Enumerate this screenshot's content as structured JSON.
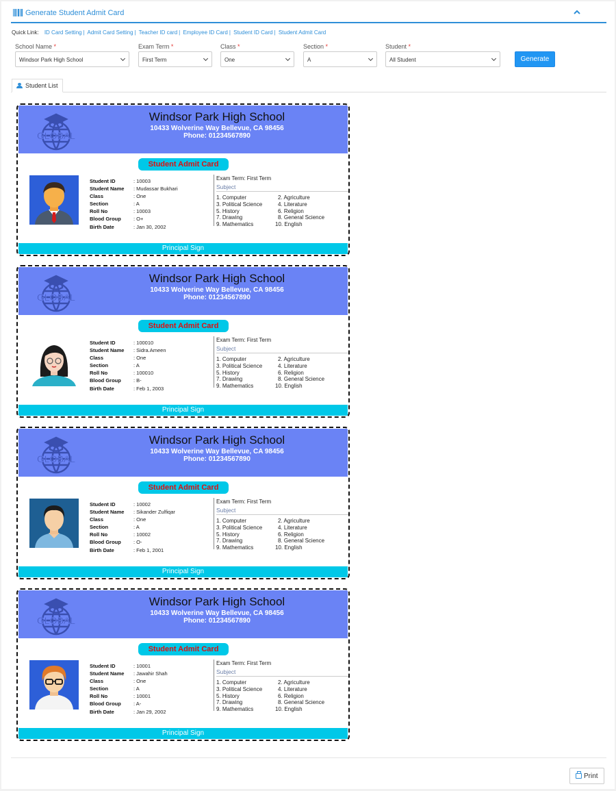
{
  "header": {
    "title": "Generate Student Admit Card",
    "collapse_icon": "chevron-up-icon"
  },
  "quick_links": {
    "label": "Quick Link:",
    "items": [
      "ID Card Setting",
      "Admit Card Setting",
      "Teacher ID card",
      "Employee ID Card",
      "Student ID Card",
      "Student Admit Card"
    ]
  },
  "filters": {
    "school": {
      "label": "School Name",
      "required": "*",
      "value": "Windsor Park High School"
    },
    "exam_term": {
      "label": "Exam Term",
      "required": "*",
      "value": "First Term"
    },
    "class": {
      "label": "Class",
      "required": "*",
      "value": "One"
    },
    "section": {
      "label": "Section",
      "required": "*",
      "value": "A"
    },
    "student": {
      "label": "Student",
      "required": "*",
      "value": "All Student"
    }
  },
  "generate_label": "Generate",
  "tab_label": "Student List",
  "field_labels": {
    "student_id": "Student ID",
    "student_name": "Student Name",
    "class": "Class",
    "section": "Section",
    "roll_no": "Roll No",
    "blood_group": "Blood Group",
    "birth_date": "Birth Date"
  },
  "card_common": {
    "school_name": "Windsor Park High School",
    "address": "10433 Wolverine Way Bellevue, CA 98456",
    "phone": "Phone: 01234567890",
    "logo_text": "GLOBAL",
    "badge": "Student Admit Card",
    "exam_term": "Exam Term: First Term",
    "subject_title": "Subject",
    "subjects": [
      "1. Computer",
      "2. Agriculture",
      "3. Political Science",
      "4. Literature",
      "5. History",
      "6. Religion",
      "7. Drawing",
      "8. General Science",
      "9. Mathematics",
      "10. English"
    ],
    "footer": "Principal Sign",
    "colors": {
      "header_bg": "#6a83f5",
      "accent": "#00c8e8",
      "badge_text": "#dd1111"
    }
  },
  "cards": [
    {
      "student_id": ": 10003",
      "student_name": ": Mudassar Bukhari",
      "class": ": One",
      "section": ": A",
      "roll_no": ": 10003",
      "blood_group": ": O+",
      "birth_date": ": Jan 30, 2002",
      "avatar": "male-avatar-tie-icon"
    },
    {
      "student_id": ": 100010",
      "student_name": ": Sidra.Ameen",
      "class": ": One",
      "section": ": A",
      "roll_no": ": 100010",
      "blood_group": ": B-",
      "birth_date": ": Feb 1, 2003",
      "avatar": "female-avatar-glasses-icon"
    },
    {
      "student_id": ": 10002",
      "student_name": ": Sikander Zulfiqar",
      "class": ": One",
      "section": ": A",
      "roll_no": ": 10002",
      "blood_group": ": O-",
      "birth_date": ": Feb 1, 2001",
      "avatar": "male-avatar-icon"
    },
    {
      "student_id": ": 10001",
      "student_name": ": Jawahir Shah",
      "class": ": One",
      "section": ": A",
      "roll_no": ": 10001",
      "blood_group": ": A-",
      "birth_date": ": Jan 29, 2002",
      "avatar": "male-avatar-glasses-icon"
    }
  ],
  "print_label": "Print"
}
